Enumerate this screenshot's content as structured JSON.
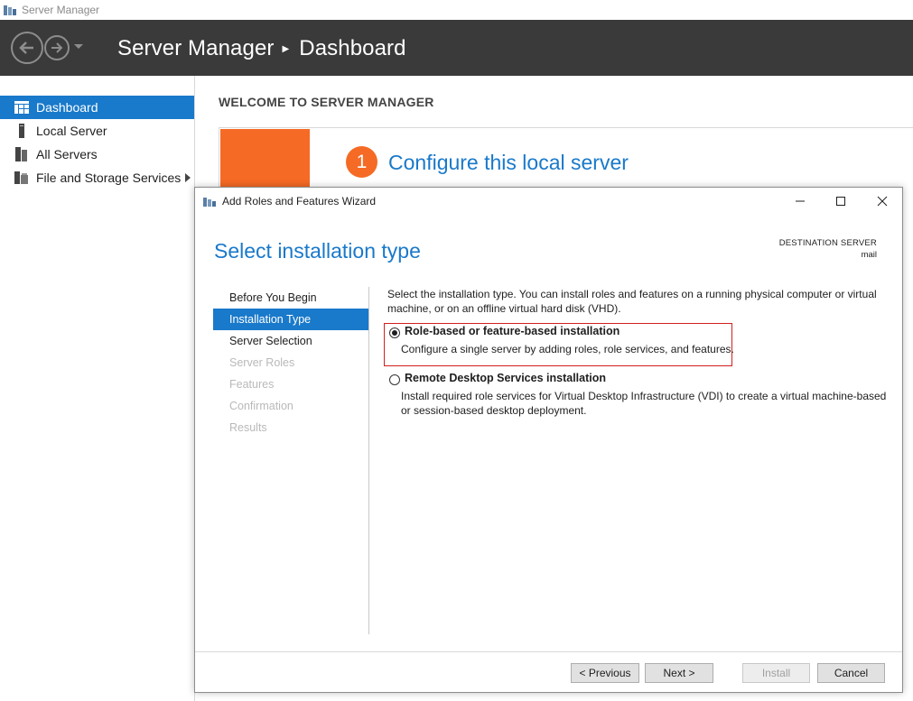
{
  "app": {
    "window_title": "Server Manager"
  },
  "header": {
    "breadcrumb_root": "Server Manager",
    "breadcrumb_current": "Dashboard"
  },
  "sidebar": {
    "items": [
      {
        "label": "Dashboard",
        "icon": "dashboard-icon",
        "active": true
      },
      {
        "label": "Local Server",
        "icon": "server-icon",
        "active": false
      },
      {
        "label": "All Servers",
        "icon": "servers-icon",
        "active": false
      },
      {
        "label": "File and Storage Services",
        "icon": "storage-icon",
        "active": false
      }
    ]
  },
  "dashboard": {
    "welcome_title": "WELCOME TO SERVER MANAGER",
    "step_number": "1",
    "step_title": "Configure this local server"
  },
  "wizard": {
    "title": "Add Roles and Features Wizard",
    "heading": "Select installation type",
    "destination_label": "DESTINATION SERVER",
    "destination_value": "mail",
    "steps": [
      {
        "label": "Before You Begin",
        "state": "normal"
      },
      {
        "label": "Installation Type",
        "state": "active"
      },
      {
        "label": "Server Selection",
        "state": "normal"
      },
      {
        "label": "Server Roles",
        "state": "disabled"
      },
      {
        "label": "Features",
        "state": "disabled"
      },
      {
        "label": "Confirmation",
        "state": "disabled"
      },
      {
        "label": "Results",
        "state": "disabled"
      }
    ],
    "description": "Select the installation type. You can install roles and features on a running physical computer or virtual machine, or on an offline virtual hard disk (VHD).",
    "options": [
      {
        "title": "Role-based or feature-based installation",
        "description": "Configure a single server by adding roles, role services, and features.",
        "selected": true
      },
      {
        "title": "Remote Desktop Services installation",
        "description": "Install required role services for Virtual Desktop Infrastructure (VDI) to create a virtual machine-based or session-based desktop deployment.",
        "selected": false
      }
    ],
    "buttons": {
      "previous": "< Previous",
      "next": "Next >",
      "install": "Install",
      "cancel": "Cancel"
    }
  },
  "colors": {
    "accent": "#1979ca",
    "header_bg": "#3a3a3a",
    "orange": "#f56a24",
    "highlight": "#d21f1f"
  }
}
